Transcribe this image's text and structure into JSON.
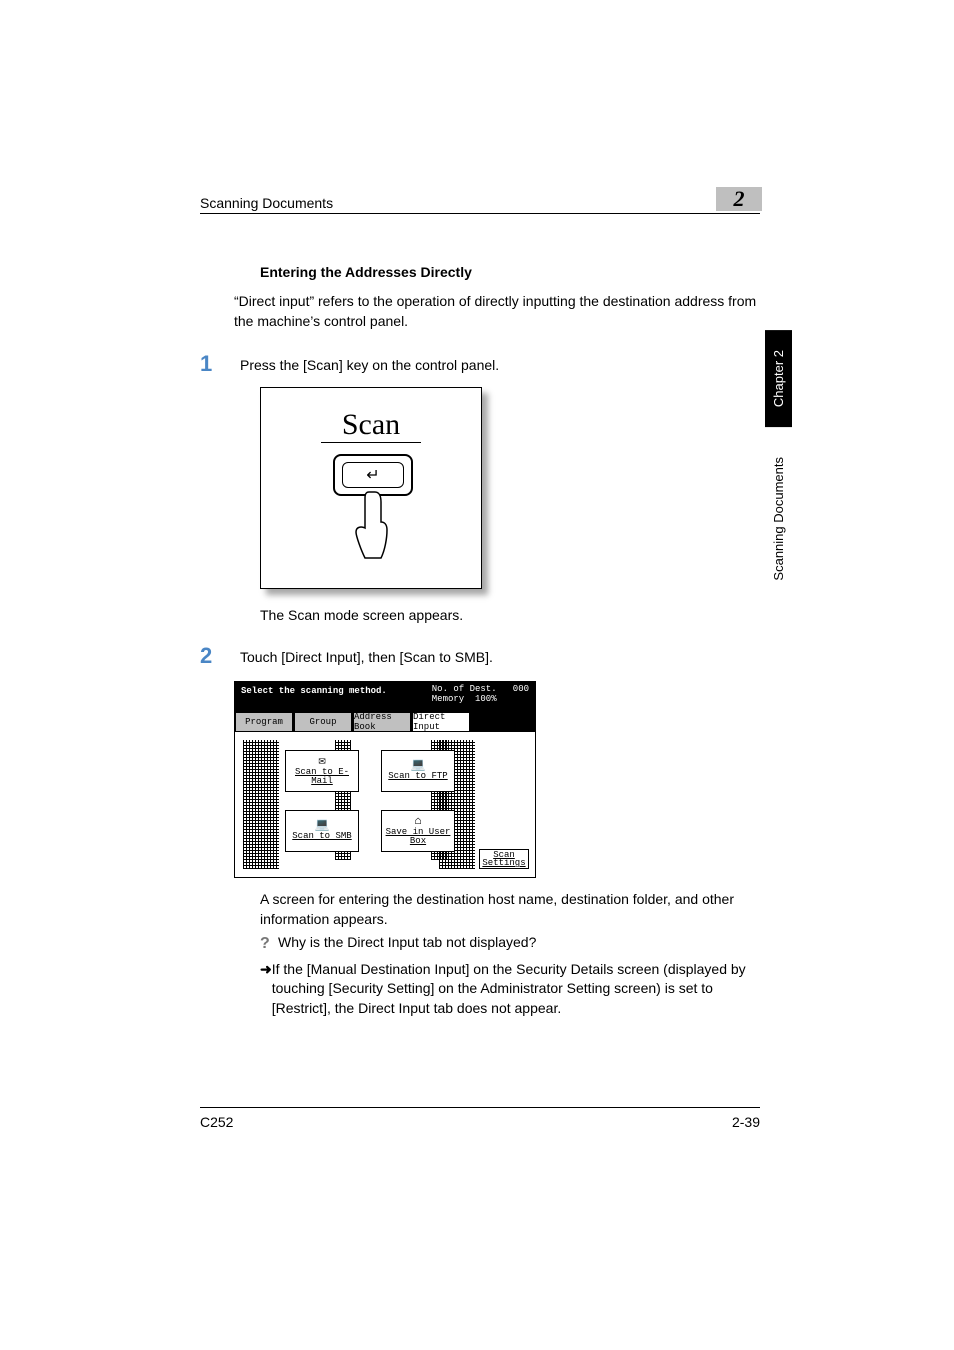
{
  "header": {
    "running_title": "Scanning Documents",
    "chapter_number": "2"
  },
  "side": {
    "chapter_label": "Chapter 2",
    "section_label": "Scanning Documents"
  },
  "section": {
    "subhead": "Entering the Addresses Directly",
    "intro": "“Direct input” refers to the operation of directly inputting the destination address from the machine’s control panel."
  },
  "steps": {
    "s1": {
      "num": "1",
      "text": "Press the [Scan] key on the control panel."
    },
    "s1_result": "The Scan mode screen appears.",
    "s2": {
      "num": "2",
      "text": "Touch [Direct Input], then [Scan to SMB]."
    },
    "s2_result": "A screen for entering the destination host name, destination folder, and other information appears."
  },
  "figure1": {
    "label": "Scan"
  },
  "figure2": {
    "instruction": "Select the scanning method.",
    "status_line1": "No. of Dest.",
    "status_count": "000",
    "status_line2": "Memory",
    "status_mem": "100%",
    "tabs": {
      "program": "Program",
      "group": "Group",
      "address_book": "Address Book",
      "direct_input": "Direct Input"
    },
    "options": {
      "email": "Scan to E-Mail",
      "ftp": "Scan to FTP",
      "smb": "Scan to SMB",
      "ubox": "Save in User Box"
    },
    "scan_settings": "Scan Settings"
  },
  "qa": {
    "question": "Why is the Direct Input tab not displayed?",
    "answer": "If the [Manual Destination Input] on the Security Details screen (displayed by touching [Security Setting] on the Administrator Setting screen) is set to [Restrict], the Direct Input tab does not appear."
  },
  "footer": {
    "left": "C252",
    "right": "2-39"
  }
}
